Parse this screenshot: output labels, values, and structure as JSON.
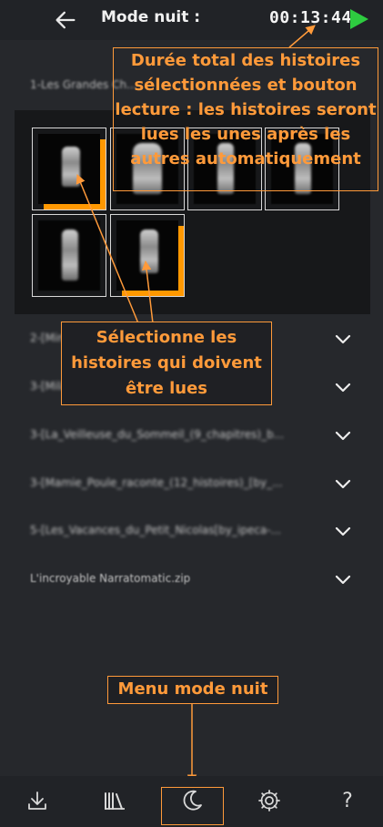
{
  "header": {
    "title": "Mode nuit :",
    "duration": "00:13:44",
    "icons": {
      "back": "arrow-left-icon",
      "play": "play-icon"
    },
    "colors": {
      "play": "#2ecc40"
    }
  },
  "groups": {
    "group1": {
      "label": "1-Les Grandes Ch..."
    },
    "items": [
      {
        "label": "2-[Mini_p..._..._..._...20..."
      },
      {
        "label": "3-[Milava - Audi..._..._DEMAR[by_..."
      },
      {
        "label": "3-[La_Veilleuse_du_Sommeil_(9_chapitres)_b..."
      },
      {
        "label": "3-[Mamie_Poule_raconte_(12_histoires)_[by_..."
      },
      {
        "label": "5-[Les_Vacances_du_Petit_Nicolas[by_ipeca-..."
      },
      {
        "label": "L'incroyable Narratomatic.zip"
      }
    ]
  },
  "annotations": {
    "duration_note": "Durée total des histoires sélectionnées et bouton lecture : les histoires seront lues les unes après les autres automatiquement",
    "select_note": "Sélectionne les histoires qui doivent être lues",
    "menu_note": "Menu mode nuit"
  },
  "nav": {
    "items": [
      "download-icon",
      "library-icon",
      "moon-icon",
      "settings-icon",
      "help-icon"
    ],
    "help_glyph": "?"
  },
  "colors": {
    "accent": "#ff9a3a",
    "selected": "#ff9800",
    "background": "#26282c"
  }
}
